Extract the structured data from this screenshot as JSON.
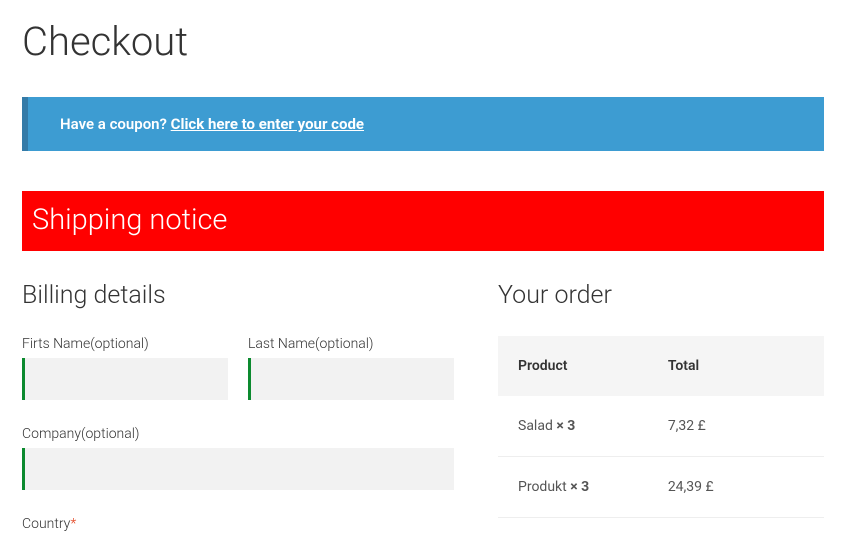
{
  "page_title": "Checkout",
  "coupon": {
    "prompt": "Have a coupon? ",
    "link_text": "Click here to enter your code"
  },
  "notice": {
    "text": "Shipping notice"
  },
  "billing": {
    "heading": "Billing details",
    "first_name_label": "Firts Name(optional)",
    "last_name_label": "Last Name(optional)",
    "company_label": "Company(optional)",
    "country_label": "Country",
    "required_mark": "*"
  },
  "order": {
    "heading": "Your order",
    "header_product": "Product",
    "header_total": "Total",
    "items": [
      {
        "name": "Salad ",
        "qty": "× 3",
        "total": "7,32 £"
      },
      {
        "name": "Produkt ",
        "qty": "× 3",
        "total": "24,39 £"
      }
    ]
  }
}
